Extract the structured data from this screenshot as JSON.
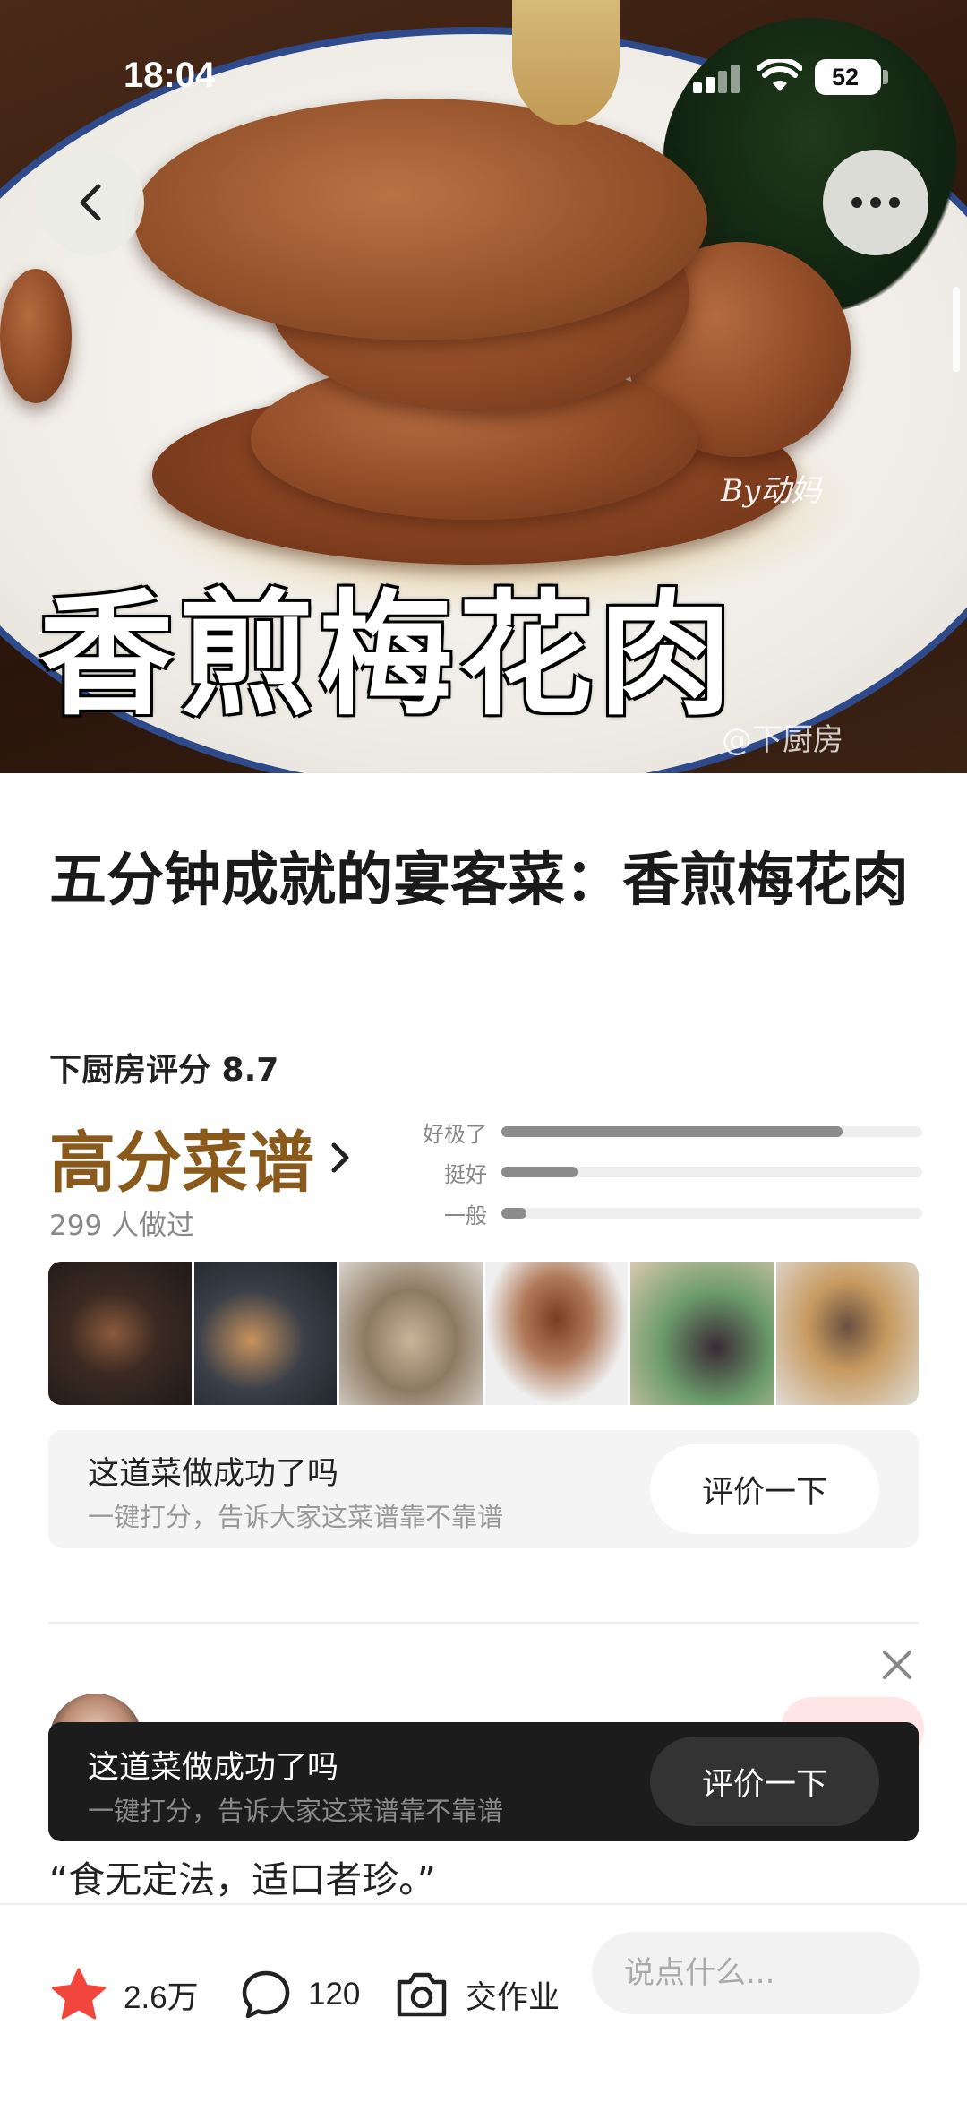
{
  "status_bar": {
    "time": "18:04",
    "battery": "52"
  },
  "hero": {
    "overlay_title": "香煎梅花肉",
    "signature": "By动妈",
    "credit": "@下厨房"
  },
  "recipe": {
    "title": "五分钟成就的宴客菜：香煎梅花肉",
    "rating_label": "下厨房评分 8.7",
    "grade": "高分菜谱",
    "made_count": "299 人做过",
    "rating_bars": [
      {
        "label": "好极了",
        "fraction": 0.81
      },
      {
        "label": "挺好",
        "fraction": 0.18
      },
      {
        "label": "一般",
        "fraction": 0.06
      }
    ]
  },
  "review_card": {
    "title": "这道菜做成功了吗",
    "subtitle": "一键打分，告诉大家这菜谱靠不靠谱",
    "button": "评价一下"
  },
  "toast": {
    "title": "这道菜做成功了吗",
    "subtitle": "一键打分，告诉大家这菜谱靠不靠谱",
    "button": "评价一下"
  },
  "quote": "“食无定法，适口者珍。”",
  "bottom_bar": {
    "favorites": "2.6万",
    "comments": "120",
    "homework": "交作业",
    "comment_placeholder": "说点什么..."
  },
  "colors": {
    "grade": "#8a5a1c",
    "star": "#f0463c",
    "toast_bg": "#1c1c1c"
  }
}
